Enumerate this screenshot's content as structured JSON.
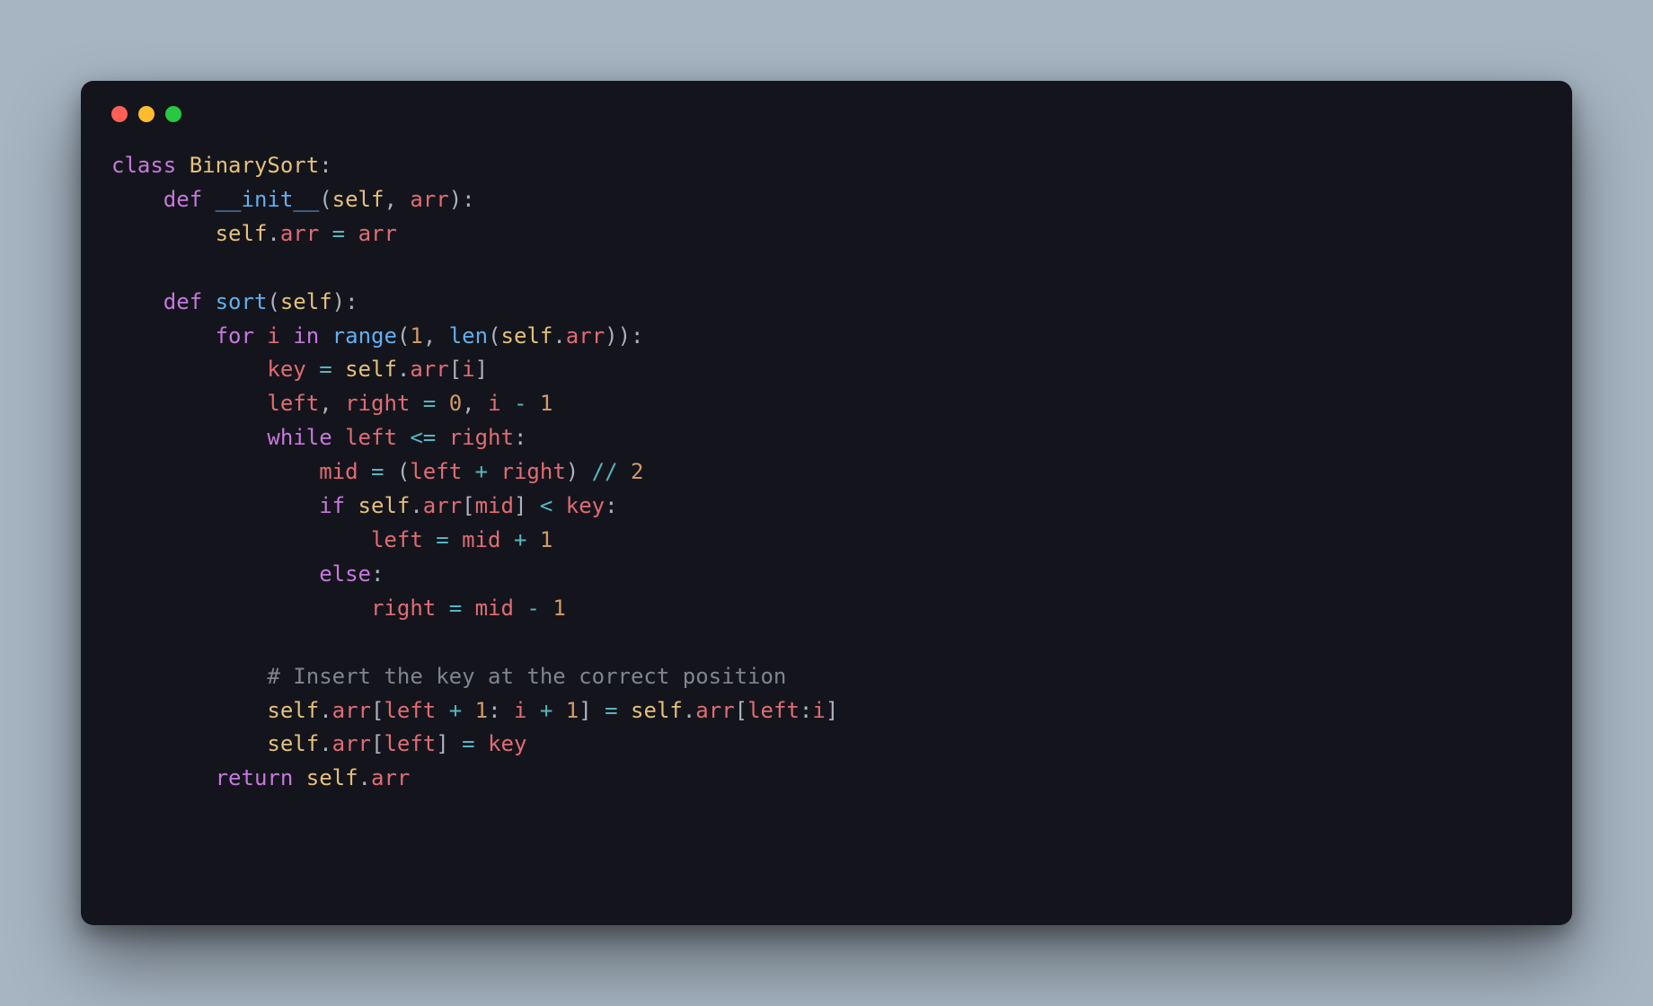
{
  "window": {
    "traffic_colors": {
      "close": "#ff5f57",
      "min": "#febc2e",
      "max": "#28c840"
    }
  },
  "code": {
    "lines": [
      [
        {
          "c": "tok-kw",
          "t": "class"
        },
        {
          "c": "tok-plain",
          "t": " "
        },
        {
          "c": "tok-cls",
          "t": "BinarySort"
        },
        {
          "c": "tok-punc",
          "t": ":"
        }
      ],
      [
        {
          "c": "tok-plain",
          "t": "    "
        },
        {
          "c": "tok-kw",
          "t": "def"
        },
        {
          "c": "tok-plain",
          "t": " "
        },
        {
          "c": "tok-fn",
          "t": "__init__"
        },
        {
          "c": "tok-punc",
          "t": "("
        },
        {
          "c": "tok-self",
          "t": "self"
        },
        {
          "c": "tok-punc",
          "t": ", "
        },
        {
          "c": "tok-param",
          "t": "arr"
        },
        {
          "c": "tok-punc",
          "t": "):"
        }
      ],
      [
        {
          "c": "tok-plain",
          "t": "        "
        },
        {
          "c": "tok-self",
          "t": "self"
        },
        {
          "c": "tok-punc",
          "t": "."
        },
        {
          "c": "tok-attr",
          "t": "arr"
        },
        {
          "c": "tok-plain",
          "t": " "
        },
        {
          "c": "tok-op",
          "t": "="
        },
        {
          "c": "tok-plain",
          "t": " "
        },
        {
          "c": "tok-param",
          "t": "arr"
        }
      ],
      [],
      [
        {
          "c": "tok-plain",
          "t": "    "
        },
        {
          "c": "tok-kw",
          "t": "def"
        },
        {
          "c": "tok-plain",
          "t": " "
        },
        {
          "c": "tok-fn",
          "t": "sort"
        },
        {
          "c": "tok-punc",
          "t": "("
        },
        {
          "c": "tok-self",
          "t": "self"
        },
        {
          "c": "tok-punc",
          "t": "):"
        }
      ],
      [
        {
          "c": "tok-plain",
          "t": "        "
        },
        {
          "c": "tok-kw",
          "t": "for"
        },
        {
          "c": "tok-plain",
          "t": " "
        },
        {
          "c": "tok-param",
          "t": "i"
        },
        {
          "c": "tok-plain",
          "t": " "
        },
        {
          "c": "tok-kw",
          "t": "in"
        },
        {
          "c": "tok-plain",
          "t": " "
        },
        {
          "c": "tok-fn",
          "t": "range"
        },
        {
          "c": "tok-punc",
          "t": "("
        },
        {
          "c": "tok-num",
          "t": "1"
        },
        {
          "c": "tok-punc",
          "t": ", "
        },
        {
          "c": "tok-fn",
          "t": "len"
        },
        {
          "c": "tok-punc",
          "t": "("
        },
        {
          "c": "tok-self",
          "t": "self"
        },
        {
          "c": "tok-punc",
          "t": "."
        },
        {
          "c": "tok-attr",
          "t": "arr"
        },
        {
          "c": "tok-punc",
          "t": ")):"
        }
      ],
      [
        {
          "c": "tok-plain",
          "t": "            "
        },
        {
          "c": "tok-param",
          "t": "key"
        },
        {
          "c": "tok-plain",
          "t": " "
        },
        {
          "c": "tok-op",
          "t": "="
        },
        {
          "c": "tok-plain",
          "t": " "
        },
        {
          "c": "tok-self",
          "t": "self"
        },
        {
          "c": "tok-punc",
          "t": "."
        },
        {
          "c": "tok-attr",
          "t": "arr"
        },
        {
          "c": "tok-punc",
          "t": "["
        },
        {
          "c": "tok-param",
          "t": "i"
        },
        {
          "c": "tok-punc",
          "t": "]"
        }
      ],
      [
        {
          "c": "tok-plain",
          "t": "            "
        },
        {
          "c": "tok-param",
          "t": "left"
        },
        {
          "c": "tok-punc",
          "t": ", "
        },
        {
          "c": "tok-param",
          "t": "right"
        },
        {
          "c": "tok-plain",
          "t": " "
        },
        {
          "c": "tok-op",
          "t": "="
        },
        {
          "c": "tok-plain",
          "t": " "
        },
        {
          "c": "tok-num",
          "t": "0"
        },
        {
          "c": "tok-punc",
          "t": ", "
        },
        {
          "c": "tok-param",
          "t": "i"
        },
        {
          "c": "tok-plain",
          "t": " "
        },
        {
          "c": "tok-op",
          "t": "-"
        },
        {
          "c": "tok-plain",
          "t": " "
        },
        {
          "c": "tok-num",
          "t": "1"
        }
      ],
      [
        {
          "c": "tok-plain",
          "t": "            "
        },
        {
          "c": "tok-kw",
          "t": "while"
        },
        {
          "c": "tok-plain",
          "t": " "
        },
        {
          "c": "tok-param",
          "t": "left"
        },
        {
          "c": "tok-plain",
          "t": " "
        },
        {
          "c": "tok-op",
          "t": "<="
        },
        {
          "c": "tok-plain",
          "t": " "
        },
        {
          "c": "tok-param",
          "t": "right"
        },
        {
          "c": "tok-punc",
          "t": ":"
        }
      ],
      [
        {
          "c": "tok-plain",
          "t": "                "
        },
        {
          "c": "tok-param",
          "t": "mid"
        },
        {
          "c": "tok-plain",
          "t": " "
        },
        {
          "c": "tok-op",
          "t": "="
        },
        {
          "c": "tok-plain",
          "t": " "
        },
        {
          "c": "tok-punc",
          "t": "("
        },
        {
          "c": "tok-param",
          "t": "left"
        },
        {
          "c": "tok-plain",
          "t": " "
        },
        {
          "c": "tok-op",
          "t": "+"
        },
        {
          "c": "tok-plain",
          "t": " "
        },
        {
          "c": "tok-param",
          "t": "right"
        },
        {
          "c": "tok-punc",
          "t": ") "
        },
        {
          "c": "tok-op",
          "t": "//"
        },
        {
          "c": "tok-plain",
          "t": " "
        },
        {
          "c": "tok-num",
          "t": "2"
        }
      ],
      [
        {
          "c": "tok-plain",
          "t": "                "
        },
        {
          "c": "tok-kw",
          "t": "if"
        },
        {
          "c": "tok-plain",
          "t": " "
        },
        {
          "c": "tok-self",
          "t": "self"
        },
        {
          "c": "tok-punc",
          "t": "."
        },
        {
          "c": "tok-attr",
          "t": "arr"
        },
        {
          "c": "tok-punc",
          "t": "["
        },
        {
          "c": "tok-param",
          "t": "mid"
        },
        {
          "c": "tok-punc",
          "t": "] "
        },
        {
          "c": "tok-op",
          "t": "<"
        },
        {
          "c": "tok-plain",
          "t": " "
        },
        {
          "c": "tok-param",
          "t": "key"
        },
        {
          "c": "tok-punc",
          "t": ":"
        }
      ],
      [
        {
          "c": "tok-plain",
          "t": "                    "
        },
        {
          "c": "tok-param",
          "t": "left"
        },
        {
          "c": "tok-plain",
          "t": " "
        },
        {
          "c": "tok-op",
          "t": "="
        },
        {
          "c": "tok-plain",
          "t": " "
        },
        {
          "c": "tok-param",
          "t": "mid"
        },
        {
          "c": "tok-plain",
          "t": " "
        },
        {
          "c": "tok-op",
          "t": "+"
        },
        {
          "c": "tok-plain",
          "t": " "
        },
        {
          "c": "tok-num",
          "t": "1"
        }
      ],
      [
        {
          "c": "tok-plain",
          "t": "                "
        },
        {
          "c": "tok-kw",
          "t": "else"
        },
        {
          "c": "tok-punc",
          "t": ":"
        }
      ],
      [
        {
          "c": "tok-plain",
          "t": "                    "
        },
        {
          "c": "tok-param",
          "t": "right"
        },
        {
          "c": "tok-plain",
          "t": " "
        },
        {
          "c": "tok-op",
          "t": "="
        },
        {
          "c": "tok-plain",
          "t": " "
        },
        {
          "c": "tok-param",
          "t": "mid"
        },
        {
          "c": "tok-plain",
          "t": " "
        },
        {
          "c": "tok-op",
          "t": "-"
        },
        {
          "c": "tok-plain",
          "t": " "
        },
        {
          "c": "tok-num",
          "t": "1"
        }
      ],
      [],
      [
        {
          "c": "tok-plain",
          "t": "            "
        },
        {
          "c": "tok-com",
          "t": "# Insert the key at the correct position"
        }
      ],
      [
        {
          "c": "tok-plain",
          "t": "            "
        },
        {
          "c": "tok-self",
          "t": "self"
        },
        {
          "c": "tok-punc",
          "t": "."
        },
        {
          "c": "tok-attr",
          "t": "arr"
        },
        {
          "c": "tok-punc",
          "t": "["
        },
        {
          "c": "tok-param",
          "t": "left"
        },
        {
          "c": "tok-plain",
          "t": " "
        },
        {
          "c": "tok-op",
          "t": "+"
        },
        {
          "c": "tok-plain",
          "t": " "
        },
        {
          "c": "tok-num",
          "t": "1"
        },
        {
          "c": "tok-punc",
          "t": ": "
        },
        {
          "c": "tok-param",
          "t": "i"
        },
        {
          "c": "tok-plain",
          "t": " "
        },
        {
          "c": "tok-op",
          "t": "+"
        },
        {
          "c": "tok-plain",
          "t": " "
        },
        {
          "c": "tok-num",
          "t": "1"
        },
        {
          "c": "tok-punc",
          "t": "] "
        },
        {
          "c": "tok-op",
          "t": "="
        },
        {
          "c": "tok-plain",
          "t": " "
        },
        {
          "c": "tok-self",
          "t": "self"
        },
        {
          "c": "tok-punc",
          "t": "."
        },
        {
          "c": "tok-attr",
          "t": "arr"
        },
        {
          "c": "tok-punc",
          "t": "["
        },
        {
          "c": "tok-param",
          "t": "left"
        },
        {
          "c": "tok-punc",
          "t": ":"
        },
        {
          "c": "tok-param",
          "t": "i"
        },
        {
          "c": "tok-punc",
          "t": "]"
        }
      ],
      [
        {
          "c": "tok-plain",
          "t": "            "
        },
        {
          "c": "tok-self",
          "t": "self"
        },
        {
          "c": "tok-punc",
          "t": "."
        },
        {
          "c": "tok-attr",
          "t": "arr"
        },
        {
          "c": "tok-punc",
          "t": "["
        },
        {
          "c": "tok-param",
          "t": "left"
        },
        {
          "c": "tok-punc",
          "t": "] "
        },
        {
          "c": "tok-op",
          "t": "="
        },
        {
          "c": "tok-plain",
          "t": " "
        },
        {
          "c": "tok-param",
          "t": "key"
        }
      ],
      [
        {
          "c": "tok-plain",
          "t": "        "
        },
        {
          "c": "tok-kw",
          "t": "return"
        },
        {
          "c": "tok-plain",
          "t": " "
        },
        {
          "c": "tok-self",
          "t": "self"
        },
        {
          "c": "tok-punc",
          "t": "."
        },
        {
          "c": "tok-attr",
          "t": "arr"
        }
      ]
    ]
  }
}
